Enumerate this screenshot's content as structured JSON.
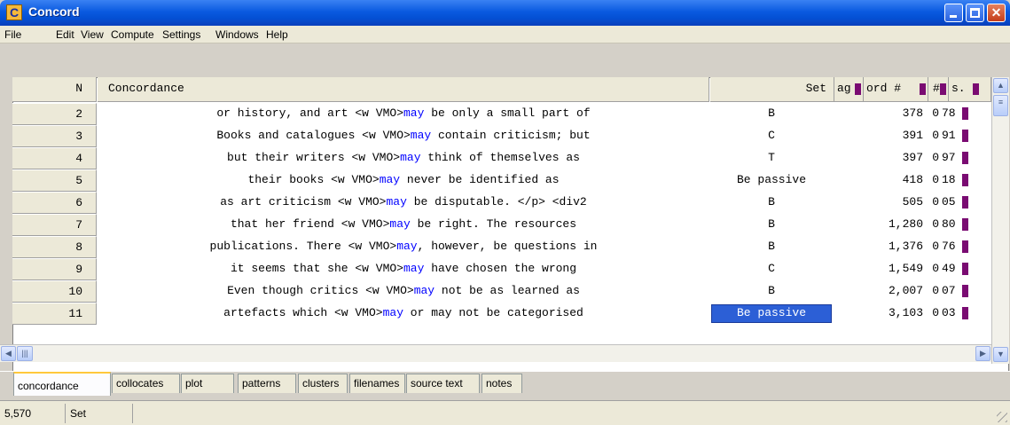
{
  "window": {
    "title": "Concord",
    "app_icon": "C",
    "controls": [
      "minimize",
      "maximize",
      "close"
    ]
  },
  "menu": [
    "File",
    "Edit",
    "View",
    "Compute",
    "Settings",
    "Windows",
    "Help"
  ],
  "columns": {
    "n": "N",
    "concordance": "Concordance",
    "set": "Set",
    "tag": "ag",
    "word": "ord #",
    "hash": "#",
    "s": "s."
  },
  "rows": [
    {
      "n": "2",
      "left": "or history, and art <w VMO>",
      "kw": "may",
      "right": " be only a small part of",
      "set": "B",
      "word": "378",
      "z": "0",
      "pct": "78"
    },
    {
      "n": "3",
      "left": "Books and catalogues <w VMO>",
      "kw": "may",
      "right": " contain criticism; but",
      "set": "C",
      "word": "391",
      "z": "0",
      "pct": "91"
    },
    {
      "n": "4",
      "left": "but their writers <w VMO>",
      "kw": "may",
      "right": " think of themselves as",
      "set": "T",
      "word": "397",
      "z": "0",
      "pct": "97"
    },
    {
      "n": "5",
      "left": "their books <w VMO>",
      "kw": "may",
      "right": " never be identified as",
      "set": "Be passive",
      "word": "418",
      "z": "0",
      "pct": "18"
    },
    {
      "n": "6",
      "left": "as art criticism <w VMO>",
      "kw": "may",
      "right": " be disputable. </p> <div2",
      "set": "B",
      "word": "505",
      "z": "0",
      "pct": "05"
    },
    {
      "n": "7",
      "left": "that her friend <w VMO>",
      "kw": "may",
      "right": " be right. The resources",
      "set": "B",
      "word": "1,280",
      "z": "0",
      "pct": "80"
    },
    {
      "n": "8",
      "left": "publications. There <w VMO>",
      "kw": "may",
      "right": ", however, be questions in",
      "set": "B",
      "word": "1,376",
      "z": "0",
      "pct": "76"
    },
    {
      "n": "9",
      "left": "it seems that she <w VMO>",
      "kw": "may",
      "right": " have chosen the wrong",
      "set": "C",
      "word": "1,549",
      "z": "0",
      "pct": "49"
    },
    {
      "n": "10",
      "left": "Even though critics <w VMO>",
      "kw": "may",
      "right": " not be as learned as",
      "set": "B",
      "word": "2,007",
      "z": "0",
      "pct": "07"
    },
    {
      "n": "11",
      "left": "artefacts which <w VMO>",
      "kw": "may",
      "right": " or may not be categorised",
      "set": "Be passive",
      "word": "3,103",
      "z": "0",
      "pct": "03"
    }
  ],
  "tabs": [
    "concordance",
    "collocates",
    "plot",
    "patterns",
    "clusters",
    "filenames",
    "source text",
    "notes"
  ],
  "status": {
    "count": "5,570",
    "label": "Set"
  },
  "colors": {
    "keyword": "#0000ff",
    "bar": "#7a0b72",
    "selection": "#2c5fd6",
    "title_bar": "#0a5ae0"
  }
}
